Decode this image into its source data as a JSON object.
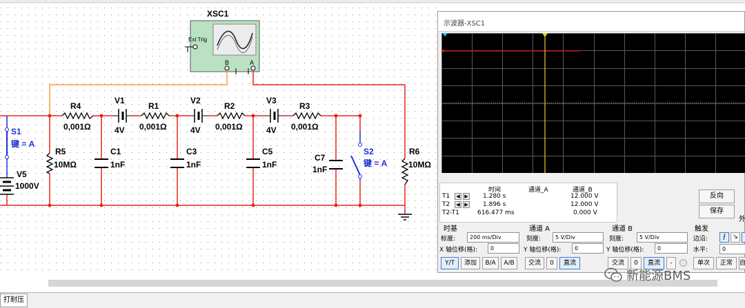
{
  "schematic": {
    "instrument_label": "XSC1",
    "ext_trig_label": "Ext Trig",
    "port_b": "B",
    "port_a": "A",
    "resistors_series": [
      {
        "name": "R4",
        "value": "0,001Ω"
      },
      {
        "name": "R1",
        "value": "0,001Ω"
      },
      {
        "name": "R2",
        "value": "0,001Ω"
      },
      {
        "name": "R3",
        "value": "0,001Ω"
      }
    ],
    "batteries": [
      {
        "name": "V1",
        "value": "4V"
      },
      {
        "name": "V2",
        "value": "4V"
      },
      {
        "name": "V3",
        "value": "4V"
      }
    ],
    "capacitors": [
      {
        "name": "C1",
        "value": "1nF"
      },
      {
        "name": "C3",
        "value": "1nF"
      },
      {
        "name": "C5",
        "value": "1nF"
      },
      {
        "name": "C7",
        "value": "1nF"
      }
    ],
    "r5": {
      "name": "R5",
      "value": "10MΩ"
    },
    "r6": {
      "name": "R6",
      "value": "10MΩ"
    },
    "v5": {
      "name": "V5",
      "value": "1000V"
    },
    "s1": {
      "name": "S1",
      "key": "键 = A"
    },
    "s2": {
      "name": "S2",
      "key": "键 = A"
    }
  },
  "scope": {
    "title": "示波器-XSC1",
    "readout": {
      "col_time": "时间",
      "col_a": "通道_A",
      "col_b": "通道_B",
      "rows": [
        {
          "label": "T1",
          "time": "1.280 s",
          "a": "",
          "b": "12.000 V"
        },
        {
          "label": "T2",
          "time": "1.896 s",
          "a": "",
          "b": "12.000 V"
        },
        {
          "label": "T2-T1",
          "time": "616.477 ms",
          "a": "",
          "b": "0.000 V"
        }
      ]
    },
    "buttons": {
      "reverse": "反向",
      "save": "保存",
      "external": "外"
    },
    "timebase": {
      "title": "时基",
      "scale_label": "标度:",
      "scale_value": "200 ms/Div",
      "xpos_label": "X 轴位移(格):",
      "xpos_value": "0",
      "modes": [
        "Y/T",
        "添加",
        "B/A",
        "A/B"
      ]
    },
    "channel_a": {
      "title": "通道 A",
      "scale_label": "刻度:",
      "scale_value": "5  V/Div",
      "ypos_label": "Y 轴位移(格):",
      "ypos_value": "0",
      "coupling": [
        "交流",
        "0",
        "直流"
      ]
    },
    "channel_b": {
      "title": "通道 B",
      "scale_label": "刻度:",
      "scale_value": "5  V/Div",
      "ypos_label": "Y 轴位移(格):",
      "ypos_value": "0",
      "coupling": [
        "交流",
        "0",
        "直流",
        "-"
      ]
    },
    "trigger": {
      "title": "触发",
      "edge_label": "边沿:",
      "level_label": "水平:",
      "level_value": "0",
      "modes": [
        "单次",
        "正常",
        "自"
      ]
    }
  },
  "status": {
    "tab": "打耐压"
  },
  "watermark": {
    "text": "新能源BMS"
  },
  "colors": {
    "wire_red": "#e8221c",
    "wire_orange": "#f0a040",
    "switch_blue": "#1f2fd8",
    "scope_bg": "#000000",
    "trace_red": "#c81818",
    "cursor_yellow": "#e8d21e"
  }
}
